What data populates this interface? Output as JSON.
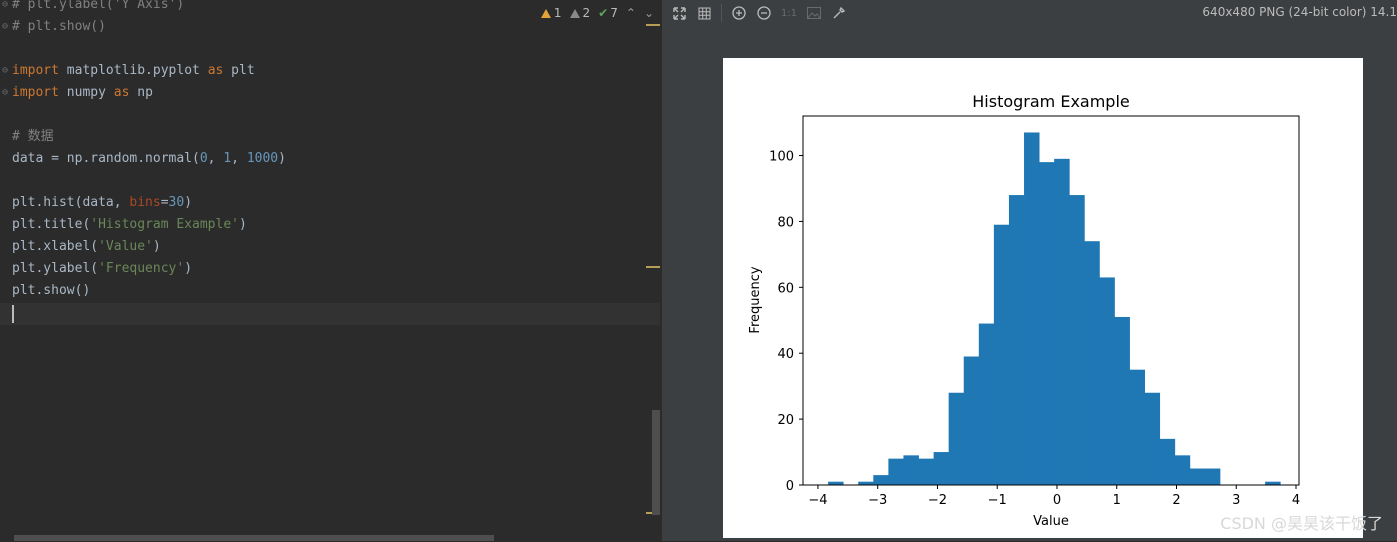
{
  "editor": {
    "lines": [
      {
        "type": "comment",
        "text": "# plt.ylabel('Y Axis')"
      },
      {
        "type": "comment",
        "text": "# plt.show()"
      },
      {
        "type": "blank",
        "text": ""
      },
      {
        "type": "import",
        "kw1": "import",
        "mod": " matplotlib.pyplot ",
        "kw2": "as",
        "alias": " plt"
      },
      {
        "type": "import",
        "kw1": "import",
        "mod": " numpy ",
        "kw2": "as",
        "alias": " np"
      },
      {
        "type": "blank",
        "text": ""
      },
      {
        "type": "comment",
        "text": "# 数据"
      },
      {
        "type": "call",
        "pre": "data = np.random.normal(",
        "args": [
          "0",
          "1",
          "1000"
        ],
        "post": ")"
      },
      {
        "type": "blank",
        "text": ""
      },
      {
        "type": "hist",
        "pre": "plt.hist(data, ",
        "param": "bins",
        "eq": "=",
        "num": "30",
        "post": ")"
      },
      {
        "type": "strcall",
        "pre": "plt.title(",
        "str": "'Histogram Example'",
        "post": ")"
      },
      {
        "type": "strcall",
        "pre": "plt.xlabel(",
        "str": "'Value'",
        "post": ")"
      },
      {
        "type": "strcall",
        "pre": "plt.ylabel(",
        "str": "'Frequency'",
        "post": ")"
      },
      {
        "type": "plain",
        "text": "plt.show()"
      }
    ],
    "inspections": {
      "warnings": "1",
      "weak_warnings": "2",
      "typos": "7"
    }
  },
  "viewer": {
    "image_info": "640x480 PNG (24-bit color) 14.1",
    "toolbar_icons": [
      "fit-icon",
      "grid-icon",
      "zoom-in-icon",
      "zoom-out-icon",
      "actual-size-icon",
      "background-icon",
      "color-picker-icon"
    ],
    "actual_size_label": "1:1"
  },
  "chart_data": {
    "type": "bar",
    "title": "Histogram Example",
    "xlabel": "Value",
    "ylabel": "Frequency",
    "xlim": [
      -4.25,
      4.05
    ],
    "ylim": [
      0,
      112
    ],
    "bin_start": -3.83,
    "bin_width": 0.2522,
    "values": [
      1,
      0,
      1,
      3,
      8,
      9,
      8,
      10,
      28,
      39,
      49,
      79,
      88,
      107,
      98,
      99,
      88,
      74,
      63,
      51,
      35,
      28,
      14,
      9,
      5,
      5,
      0,
      0,
      0,
      1
    ],
    "x_ticks": [
      -4,
      -3,
      -2,
      -1,
      0,
      1,
      2,
      3,
      4
    ],
    "x_tick_labels": [
      "−4",
      "−3",
      "−2",
      "−1",
      "0",
      "1",
      "2",
      "3",
      "4"
    ],
    "y_ticks": [
      0,
      20,
      40,
      60,
      80,
      100
    ],
    "y_tick_labels": [
      "0",
      "20",
      "40",
      "60",
      "80",
      "100"
    ],
    "bar_color": "#1f77b4"
  },
  "watermark": "CSDN @昊昊该干饭了"
}
